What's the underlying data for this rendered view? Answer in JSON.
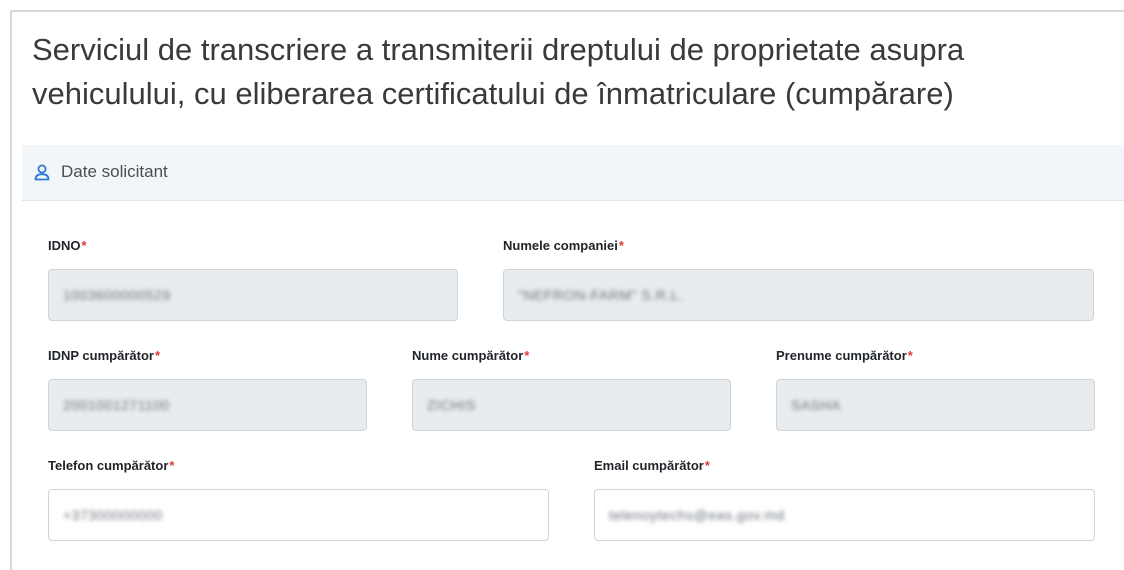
{
  "page": {
    "title_line1": "Serviciul de transcriere a transmiterii dreptului de proprietate asupra",
    "title_line2": "vehiculului, cu eliberarea certificatului de înmatriculare (cumpărare)"
  },
  "section": {
    "icon": "person-icon",
    "label": "Date solicitant"
  },
  "fields": {
    "idno": {
      "label": "IDNO",
      "required": "*",
      "value": "1003600000529"
    },
    "company": {
      "label": "Numele companiei",
      "required": "*",
      "value": "\"NEFRON-FARM\" S.R.L."
    },
    "idnp": {
      "label": "IDNP cumpărător",
      "required": "*",
      "value": "2001001271100"
    },
    "last_name": {
      "label": "Nume cumpărător",
      "required": "*",
      "value": "ZICHIS"
    },
    "first_name": {
      "label": "Prenume cumpărător",
      "required": "*",
      "value": "SASHA"
    },
    "phone": {
      "label": "Telefon cumpărător",
      "required": "*",
      "value": "+37300000000"
    },
    "email": {
      "label": "Email cumpărător",
      "required": "*",
      "value": "telenoytechs@eas.gov.md"
    }
  },
  "colors": {
    "required": "#e0383a",
    "readonly_bg": "#e9ecef",
    "section_bg": "#f3f6f9",
    "icon": "#2b7bd6"
  }
}
